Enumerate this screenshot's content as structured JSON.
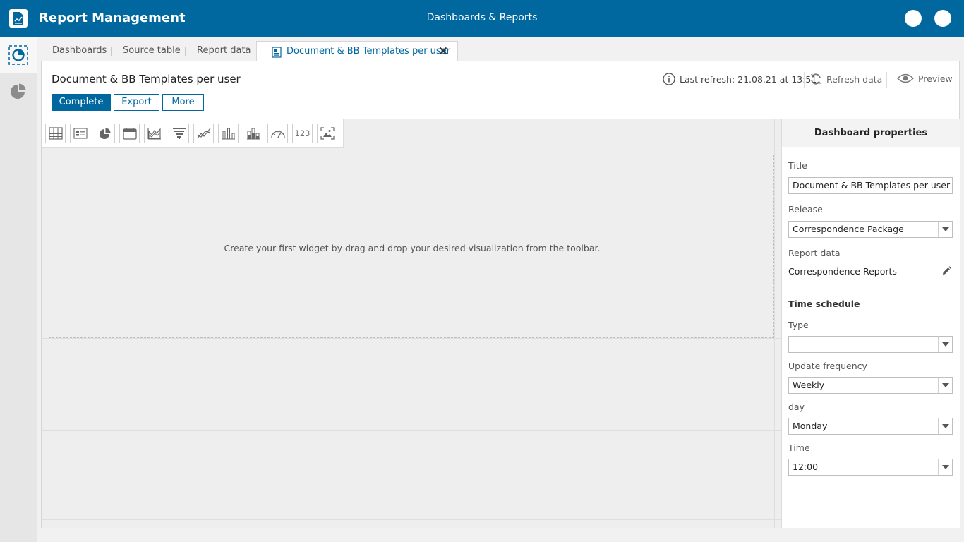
{
  "header": {
    "app_title": "Report Management",
    "center_title": "Dashboards & Reports",
    "brand_color": "#00679f"
  },
  "tabs": [
    {
      "label": "Dashboards"
    },
    {
      "label": "Source table"
    },
    {
      "label": "Report data"
    },
    {
      "label": "Document & BB Templates per user",
      "active": true
    }
  ],
  "page": {
    "title": "Document & BB Templates per user",
    "buttons": {
      "complete": "Complete",
      "export": "Export",
      "more": "More"
    },
    "last_refresh": "Last refresh: 21.08.21 at 13:51",
    "refresh_data": "Refresh data",
    "preview": "Preview"
  },
  "toolbar": {
    "tools": [
      "table-icon",
      "list-icon",
      "pie-chart-icon",
      "calendar-icon",
      "area-chart-icon",
      "funnel-icon",
      "line-chart-icon",
      "bar-chart-icon",
      "stacked-bar-chart-icon",
      "gauge-icon",
      "number-icon",
      "image-icon"
    ],
    "number_tool_label": "123"
  },
  "canvas": {
    "empty_text": "Create your first widget by drag and drop your desired visualization from the toolbar."
  },
  "properties": {
    "header": "Dashboard properties",
    "title_label": "Title",
    "title_value": "Document & BB Templates per user",
    "release_label": "Release",
    "release_value": "Correspondence Package",
    "report_data_label": "Report data",
    "report_data_value": "Correspondence Reports",
    "time_schedule_label": "Time schedule",
    "type_label": "Type",
    "type_value": "",
    "frequency_label": "Update frequency",
    "frequency_value": "Weekly",
    "day_label": "day",
    "day_value": "Monday",
    "time_label": "Time",
    "time_value": "12:00"
  }
}
